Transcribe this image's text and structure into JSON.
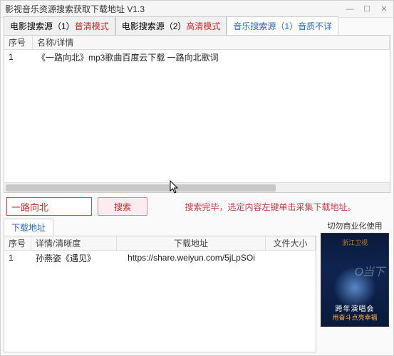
{
  "window": {
    "title": "影视音乐资源搜索获取下载地址  V1.3",
    "min": "—",
    "max": "☐",
    "close": "✕"
  },
  "tabs": {
    "items": [
      {
        "label_prefix": "电影搜索源（1）",
        "label_mode": "普清模式"
      },
      {
        "label_prefix": "电影搜索源（2）",
        "label_mode": "高清模式"
      },
      {
        "label_prefix": "音乐搜索源（1）",
        "label_mode": "音质不详"
      }
    ]
  },
  "grid1": {
    "headers": {
      "seq": "序号",
      "name": "名称/详情"
    },
    "rows": [
      {
        "seq": "1",
        "name": "《一路向北》mp3歌曲百度云下载  一路向北歌词"
      }
    ]
  },
  "search": {
    "value": "一路向北",
    "button": "搜索",
    "hint": "搜索完毕，选定内容左键单击采集下载地址。"
  },
  "dl_tab": {
    "label": "下载地址"
  },
  "grid2": {
    "headers": {
      "seq": "序号",
      "detail": "详情/清晰度",
      "url": "下载地址",
      "size": "文件大小"
    },
    "rows": [
      {
        "seq": "1",
        "detail": "孙燕姿《遇见》",
        "url": "https://share.weiyun.com/5jLpSOi",
        "size": ""
      }
    ]
  },
  "poster": {
    "warn": "切勿商业化使用",
    "top": "浙江卫视",
    "mid": "跨年演唱会",
    "bot": "用奋斗点亮幸福",
    "watermark": "O当下"
  }
}
